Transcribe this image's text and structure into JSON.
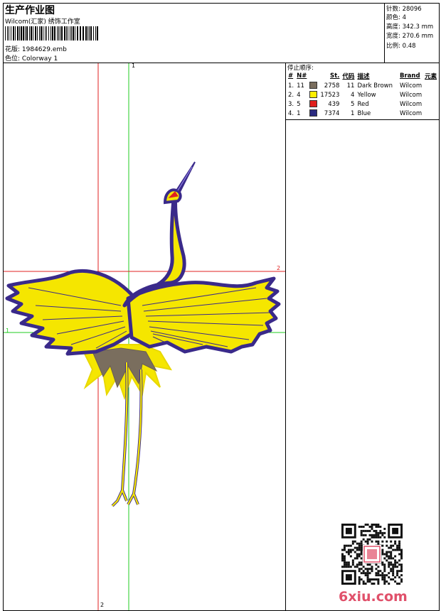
{
  "header": {
    "title": "生产作业图",
    "company": "Wilcom(汇家) 绣饰工作室",
    "design_file": "花版: 1984629.emb",
    "colorway": "色位:  Colorway 1"
  },
  "stats": [
    {
      "label": "针数",
      "value": "28096"
    },
    {
      "label": "颜色",
      "value": "4"
    },
    {
      "label": "高度",
      "value": "342.3 mm"
    },
    {
      "label": "宽度",
      "value": "270.6 mm"
    },
    {
      "label": "比例",
      "value": "0.48"
    }
  ],
  "stop_sequence": {
    "title": "停止顺序:",
    "columns": [
      "#",
      "N#",
      "St.",
      "代码",
      "描述",
      "Brand",
      "元素"
    ],
    "rows": [
      {
        "idx": "1.",
        "n": "11",
        "color": "#7a6e5e",
        "st": "2758",
        "code": "11",
        "desc": "Dark Brown",
        "brand": "Wilcom"
      },
      {
        "idx": "2.",
        "n": "4",
        "color": "#ffee00",
        "st": "17523",
        "code": "4",
        "desc": "Yellow",
        "brand": "Wilcom"
      },
      {
        "idx": "3.",
        "n": "5",
        "color": "#e0201c",
        "st": "439",
        "code": "5",
        "desc": "Red",
        "brand": "Wilcom"
      },
      {
        "idx": "4.",
        "n": "1",
        "color": "#2a2a80",
        "st": "7374",
        "code": "1",
        "desc": "Blue",
        "brand": "Wilcom"
      }
    ]
  },
  "guides": {
    "green_v": "1",
    "red_h": "2",
    "green_h": "1",
    "red_v": "2"
  },
  "watermark": "6xiu.com",
  "colors": {
    "blue_outline": "#3a2a8a",
    "yellow": "#f5e600",
    "red": "#e02020",
    "brown": "#7a6e5e",
    "guide_red": "#e02020",
    "guide_green": "#22cc22"
  }
}
